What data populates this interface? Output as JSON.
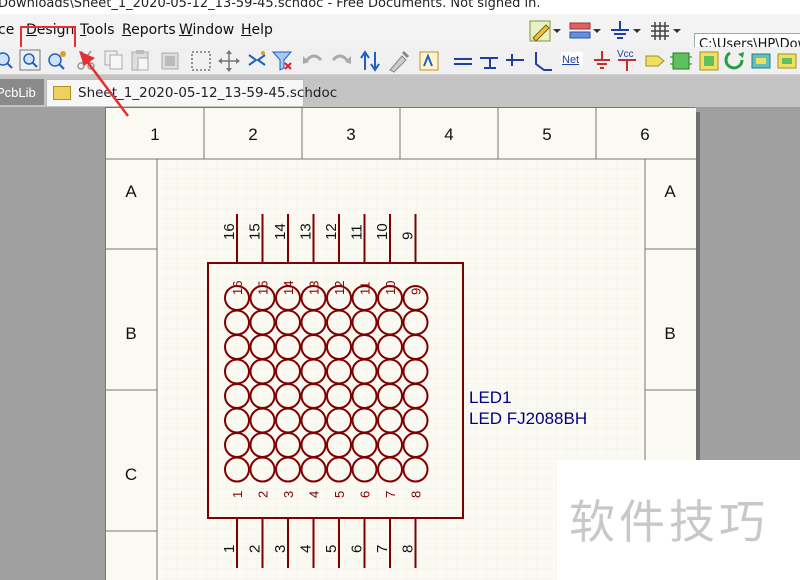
{
  "titlebar": {
    "text": "Downloads\\Sheet_1_2020-05-12_13-59-45.schdoc - Free Documents. Not signed in."
  },
  "menu": {
    "items": [
      {
        "label": "ce"
      },
      {
        "label": "Design",
        "underline": "D",
        "rest": "esign"
      },
      {
        "label": "Tools",
        "underline": "T",
        "rest": "ools"
      },
      {
        "label": "Reports",
        "underline": "R",
        "rest": "eports"
      },
      {
        "label": "Window",
        "underline": "W",
        "rest": "indow"
      },
      {
        "label": "Help",
        "underline": "H",
        "rest": "elp"
      }
    ]
  },
  "path": {
    "value": "C:\\Users\\HP\\Dow"
  },
  "tabs": [
    {
      "label": "PcbLib"
    },
    {
      "label": "Sheet_1_2020-05-12_13-59-45.schdoc"
    }
  ],
  "sheet": {
    "columns": [
      "1",
      "2",
      "3",
      "4",
      "5",
      "6"
    ],
    "rows": [
      "A",
      "B",
      "C"
    ]
  },
  "component": {
    "designator": "LED1",
    "comment": "LED FJ2088BH",
    "top_pins": [
      "16",
      "15",
      "14",
      "13",
      "12",
      "11",
      "10",
      "9"
    ],
    "bottom_pins": [
      "1",
      "2",
      "3",
      "4",
      "5",
      "6",
      "7",
      "8"
    ],
    "grid_rows": 8,
    "grid_cols": 8
  },
  "toolbar_labels": {
    "net": "Net",
    "vcc": "Vcc"
  },
  "watermark": {
    "text": "软件技巧"
  },
  "colors": {
    "highlight": "#e53030",
    "component": "#800000",
    "label": "#000080"
  }
}
